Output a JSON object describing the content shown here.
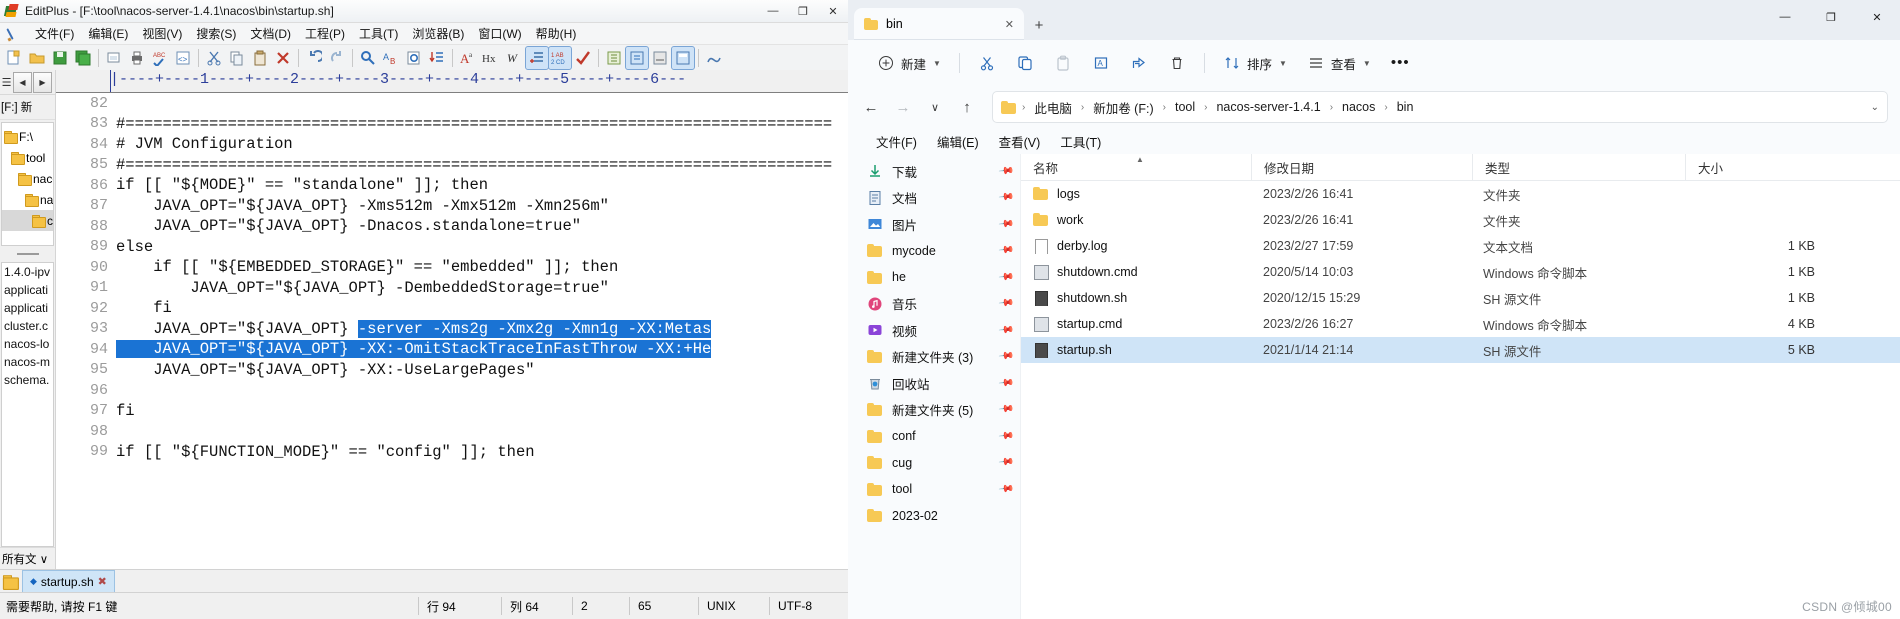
{
  "editor_window": {
    "title": "EditPlus - [F:\\tool\\nacos-server-1.4.1\\nacos\\bin\\startup.sh]",
    "window_buttons": {
      "minimize": "—",
      "maximize": "❐",
      "close": "✕"
    },
    "menus": [
      "文件(F)",
      "编辑(E)",
      "视图(V)",
      "搜索(S)",
      "文档(D)",
      "工程(P)",
      "工具(T)",
      "浏览器(B)",
      "窗口(W)",
      "帮助(H)"
    ],
    "dock": {
      "left_arrow": "◀",
      "right_arrow": "▶",
      "drive_label": "[F:] 新",
      "tree": [
        {
          "label": "F:\\",
          "indent": 0,
          "selected": false
        },
        {
          "label": "tool",
          "indent": 1,
          "selected": false
        },
        {
          "label": "naco",
          "indent": 2,
          "selected": false
        },
        {
          "label": "nac",
          "indent": 3,
          "selected": false
        },
        {
          "label": "co",
          "indent": 4,
          "selected": true
        }
      ],
      "files": [
        "1.4.0-ipv",
        "applicati",
        "applicati",
        "cluster.c",
        "nacos-lo",
        "nacos-m",
        "schema."
      ],
      "filter": "所有文 ∨"
    },
    "ruler": "|----+----1----+----2----+----3----+----4----+----5----+----6---",
    "lines": [
      {
        "num": "82",
        "segments": [
          {
            "text": "",
            "highlight": false
          }
        ]
      },
      {
        "num": "83",
        "segments": [
          {
            "text": "#============================================================================",
            "highlight": false
          }
        ]
      },
      {
        "num": "84",
        "segments": [
          {
            "text": "# JVM Configuration",
            "highlight": false
          }
        ]
      },
      {
        "num": "85",
        "segments": [
          {
            "text": "#============================================================================",
            "highlight": false
          }
        ]
      },
      {
        "num": "86",
        "segments": [
          {
            "text": "if [[ \"${MODE}\" == \"standalone\" ]]; then",
            "highlight": false
          }
        ]
      },
      {
        "num": "87",
        "segments": [
          {
            "text": "    JAVA_OPT=\"${JAVA_OPT} -Xms512m -Xmx512m -Xmn256m\"",
            "highlight": false
          }
        ]
      },
      {
        "num": "88",
        "segments": [
          {
            "text": "    JAVA_OPT=\"${JAVA_OPT} -Dnacos.standalone=true\"",
            "highlight": false
          }
        ]
      },
      {
        "num": "89",
        "segments": [
          {
            "text": "else",
            "highlight": false
          }
        ]
      },
      {
        "num": "90",
        "segments": [
          {
            "text": "    if [[ \"${EMBEDDED_STORAGE}\" == \"embedded\" ]]; then",
            "highlight": false
          }
        ]
      },
      {
        "num": "91",
        "segments": [
          {
            "text": "        JAVA_OPT=\"${JAVA_OPT} -DembeddedStorage=true\"",
            "highlight": false
          }
        ]
      },
      {
        "num": "92",
        "segments": [
          {
            "text": "    fi",
            "highlight": false
          }
        ]
      },
      {
        "num": "93",
        "segments": [
          {
            "text": "    JAVA_OPT=\"${JAVA_OPT} ",
            "highlight": false
          },
          {
            "text": "-server -Xms2g -Xmx2g -Xmn1g -XX:Metas",
            "highlight": true
          }
        ]
      },
      {
        "num": "94",
        "segments": [
          {
            "text": "    JAVA_OPT=\"${JAVA_OPT} -XX:-OmitStackTraceInFastThrow -XX:+He",
            "highlight": true
          }
        ]
      },
      {
        "num": "95",
        "segments": [
          {
            "text": "    JAVA_OPT=\"${JAVA_OPT} -XX:-UseLargePages\"",
            "highlight": false
          }
        ]
      },
      {
        "num": "96",
        "segments": [
          {
            "text": "",
            "highlight": false
          }
        ]
      },
      {
        "num": "97",
        "segments": [
          {
            "text": "fi",
            "highlight": false
          }
        ]
      },
      {
        "num": "98",
        "segments": [
          {
            "text": "",
            "highlight": false
          }
        ]
      },
      {
        "num": "99",
        "segments": [
          {
            "text": "if [[ \"${FUNCTION_MODE}\" == \"config\" ]]; then",
            "highlight": false
          }
        ]
      }
    ],
    "tab": {
      "label": "startup.sh",
      "modified_dot": "◆",
      "close": "✖"
    },
    "status": {
      "message": "需要帮助, 请按 F1 键",
      "line": "行 94",
      "column": "列 64",
      "sel": "2",
      "chars": "65",
      "eol": "UNIX",
      "encoding": "UTF-8"
    }
  },
  "explorer_window": {
    "tab": {
      "label": "bin",
      "close": "✕"
    },
    "new_tab": "+",
    "window_buttons": {
      "minimize": "—",
      "maximize": "❐",
      "close": "✕"
    },
    "command_bar": {
      "new_label": "新建",
      "cut_label": "剪切",
      "copy_label": "复制",
      "paste_label": "粘贴",
      "rename_label": "重命名",
      "share_label": "共享",
      "delete_label": "删除",
      "sort_label": "排序",
      "view_label": "查看",
      "more_label": "•••"
    },
    "nav_buttons": {
      "back": "←",
      "forward": "→",
      "recent": "∨",
      "up": "↑"
    },
    "breadcrumb": [
      "此电脑",
      "新加卷 (F:)",
      "tool",
      "nacos-server-1.4.1",
      "nacos",
      "bin"
    ],
    "breadcrumb_sep": "›",
    "menus": [
      "文件(F)",
      "编辑(E)",
      "查看(V)",
      "工具(T)"
    ],
    "nav_pane": [
      {
        "label": "下载",
        "icon": "download-icon",
        "pinned": true
      },
      {
        "label": "文档",
        "icon": "document-icon",
        "pinned": true
      },
      {
        "label": "图片",
        "icon": "picture-icon",
        "pinned": true
      },
      {
        "label": "mycode",
        "icon": "folder-icon",
        "pinned": true
      },
      {
        "label": "he",
        "icon": "folder-icon",
        "pinned": true
      },
      {
        "label": "音乐",
        "icon": "music-icon",
        "pinned": true
      },
      {
        "label": "视频",
        "icon": "video-icon",
        "pinned": true
      },
      {
        "label": "新建文件夹 (3)",
        "icon": "folder-icon",
        "pinned": true
      },
      {
        "label": "回收站",
        "icon": "recycle-bin-icon",
        "pinned": true
      },
      {
        "label": "新建文件夹 (5)",
        "icon": "folder-icon",
        "pinned": true
      },
      {
        "label": "conf",
        "icon": "folder-icon",
        "pinned": true
      },
      {
        "label": "cug",
        "icon": "folder-icon",
        "pinned": true
      },
      {
        "label": "tool",
        "icon": "folder-icon",
        "pinned": true
      },
      {
        "label": "2023-02",
        "icon": "folder-icon",
        "pinned": false
      }
    ],
    "columns": [
      "名称",
      "修改日期",
      "类型",
      "大小"
    ],
    "rows": [
      {
        "name": "logs",
        "date": "2023/2/26 16:41",
        "type": "文件夹",
        "size": "",
        "icon": "folder",
        "selected": false
      },
      {
        "name": "work",
        "date": "2023/2/26 16:41",
        "type": "文件夹",
        "size": "",
        "icon": "folder",
        "selected": false
      },
      {
        "name": "derby.log",
        "date": "2023/2/27 17:59",
        "type": "文本文档",
        "size": "1 KB",
        "icon": "txt",
        "selected": false
      },
      {
        "name": "shutdown.cmd",
        "date": "2020/5/14 10:03",
        "type": "Windows 命令脚本",
        "size": "1 KB",
        "icon": "cmd",
        "selected": false
      },
      {
        "name": "shutdown.sh",
        "date": "2020/12/15 15:29",
        "type": "SH 源文件",
        "size": "1 KB",
        "icon": "sh",
        "selected": false
      },
      {
        "name": "startup.cmd",
        "date": "2023/2/26 16:27",
        "type": "Windows 命令脚本",
        "size": "4 KB",
        "icon": "cmd",
        "selected": false
      },
      {
        "name": "startup.sh",
        "date": "2021/1/14 21:14",
        "type": "SH 源文件",
        "size": "5 KB",
        "icon": "sh",
        "selected": true
      }
    ]
  },
  "watermark": "CSDN @倾城00",
  "colors": {
    "selection_blue": "#1a73d4",
    "explorer_select": "#cfe4f7",
    "folder_yellow": "#f7c955"
  }
}
